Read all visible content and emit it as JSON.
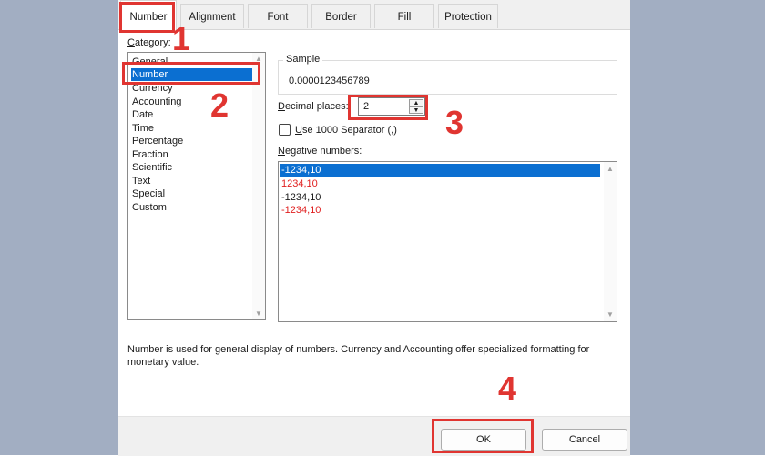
{
  "tabs": [
    {
      "label": "Number",
      "active": true
    },
    {
      "label": "Alignment"
    },
    {
      "label": "Font"
    },
    {
      "label": "Border"
    },
    {
      "label": "Fill"
    },
    {
      "label": "Protection"
    }
  ],
  "category": {
    "label_first": "C",
    "label_rest": "ategory:",
    "items": [
      "General",
      "Number",
      "Currency",
      "Accounting",
      "Date",
      "Time",
      "Percentage",
      "Fraction",
      "Scientific",
      "Text",
      "Special",
      "Custom"
    ],
    "selected": "Number"
  },
  "sample": {
    "title": "Sample",
    "value": "0.0000123456789"
  },
  "decimal": {
    "label_first": "D",
    "label_rest": "ecimal places:",
    "value": "2"
  },
  "separator": {
    "label_first": "U",
    "label_rest": "se 1000 Separator (,)",
    "checked": false
  },
  "negative": {
    "label_first": "N",
    "label_rest": "egative numbers:",
    "items": [
      {
        "text": "-1234,10",
        "color": "#1a1a1a",
        "selected": true
      },
      {
        "text": "1234,10",
        "color": "#e02020"
      },
      {
        "text": "-1234,10",
        "color": "#1a1a1a"
      },
      {
        "text": "-1234,10",
        "color": "#e02020"
      }
    ]
  },
  "description": {
    "line1": "Number is used for general display of numbers.  Currency and Accounting offer specialized formatting for",
    "line2": "monetary value."
  },
  "buttons": {
    "ok": "OK",
    "cancel": "Cancel"
  },
  "annotations": {
    "step1": "1",
    "step2": "2",
    "step3": "3",
    "step4": "4",
    "highlight_color": "#e03531"
  },
  "colors": {
    "selection": "#0b6fd1",
    "background": "#a2aec2"
  }
}
